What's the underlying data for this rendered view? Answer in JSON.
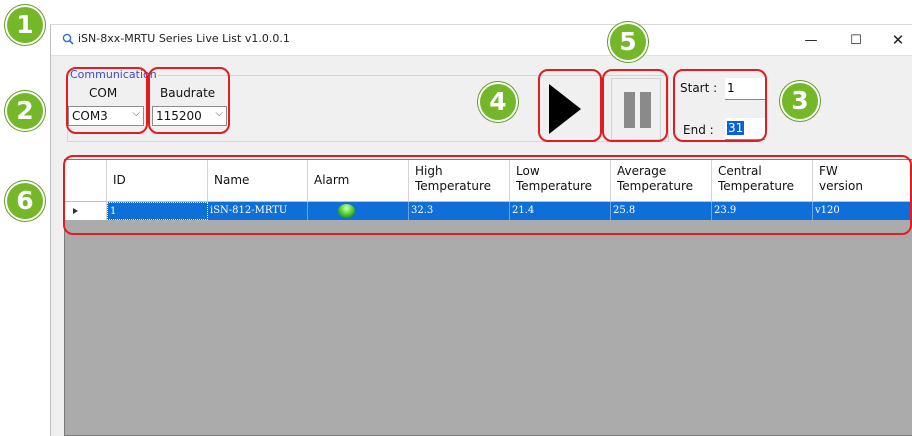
{
  "window": {
    "title": "iSN-8xx-MRTU Series Live List v1.0.0.1",
    "minimize_glyph": "—",
    "maximize_glyph": "☐",
    "close_glyph": "✕"
  },
  "communication": {
    "group_label": "Communication",
    "com_label": "COM",
    "com_value": "COM3",
    "baudrate_label": "Baudrate",
    "baudrate_value": "115200"
  },
  "range": {
    "start_label": "Start :",
    "start_value": "1",
    "end_label": "End :",
    "end_value": "31"
  },
  "grid": {
    "columns": [
      "ID",
      "Name",
      "Alarm",
      "High\nTemperature",
      "Low\nTemperature",
      "Average\nTemperature",
      "Central\nTemperature",
      "FW\nversion"
    ],
    "rows": [
      {
        "id": "1",
        "name": "iSN-812-MRTU",
        "alarm": "green",
        "high": "32.3",
        "low": "21.4",
        "average": "25.8",
        "central": "23.9",
        "fw": "v120"
      }
    ]
  },
  "callouts": [
    "1",
    "2",
    "3",
    "4",
    "5",
    "6"
  ],
  "colors": {
    "callout_border": "#e11d21",
    "badge": "#74b82a",
    "selection": "#0f6fd8",
    "group_legend": "#3d4bd6"
  },
  "icons": {
    "app": "search-icon",
    "start": "play-icon",
    "stop": "pause-icon",
    "dropdown": "chevron-down-icon",
    "row_indicator": "triangle-right-icon",
    "alarm": "green-led-icon"
  }
}
